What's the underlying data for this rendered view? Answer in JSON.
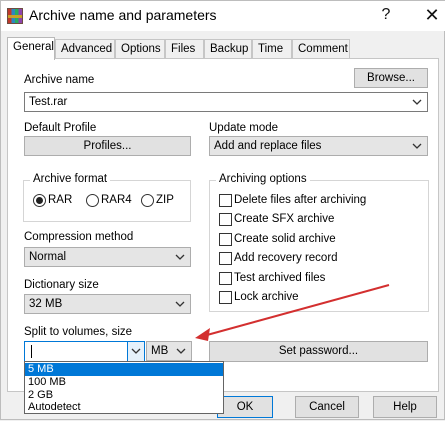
{
  "window": {
    "title": "Archive name and parameters",
    "help_symbol": "?",
    "close_symbol": "✕"
  },
  "tabs": [
    "General",
    "Advanced",
    "Options",
    "Files",
    "Backup",
    "Time",
    "Comment"
  ],
  "active_tab": "General",
  "archive_name": {
    "label": "Archive name",
    "value": "Test.rar",
    "browse_label": "Browse..."
  },
  "default_profile": {
    "label": "Default Profile",
    "button_label": "Profiles..."
  },
  "update_mode": {
    "label": "Update mode",
    "value": "Add and replace files"
  },
  "archive_format": {
    "label": "Archive format",
    "options": [
      "RAR",
      "RAR4",
      "ZIP"
    ],
    "selected": "RAR"
  },
  "archiving_options": {
    "label": "Archiving options",
    "items": [
      {
        "label": "Delete files after archiving",
        "checked": false
      },
      {
        "label": "Create SFX archive",
        "checked": false
      },
      {
        "label": "Create solid archive",
        "checked": false
      },
      {
        "label": "Add recovery record",
        "checked": false
      },
      {
        "label": "Test archived files",
        "checked": false
      },
      {
        "label": "Lock archive",
        "checked": false
      }
    ]
  },
  "compression_method": {
    "label": "Compression method",
    "value": "Normal"
  },
  "dictionary_size": {
    "label": "Dictionary size",
    "value": "32 MB"
  },
  "split_volumes": {
    "label": "Split to volumes, size",
    "value": "",
    "unit": "MB",
    "dropdown_options": [
      "5 MB",
      "100 MB",
      "2 GB",
      "Autodetect"
    ],
    "highlighted_option": "5 MB"
  },
  "set_password_label": "Set password...",
  "bottom_buttons": {
    "ok": "OK",
    "cancel": "Cancel",
    "help": "Help"
  },
  "colors": {
    "accent": "#0078d7",
    "annotation_arrow": "#d32f2f"
  },
  "icons": {
    "app": "winrar-icon",
    "dropdown": "chevron-down-icon"
  }
}
